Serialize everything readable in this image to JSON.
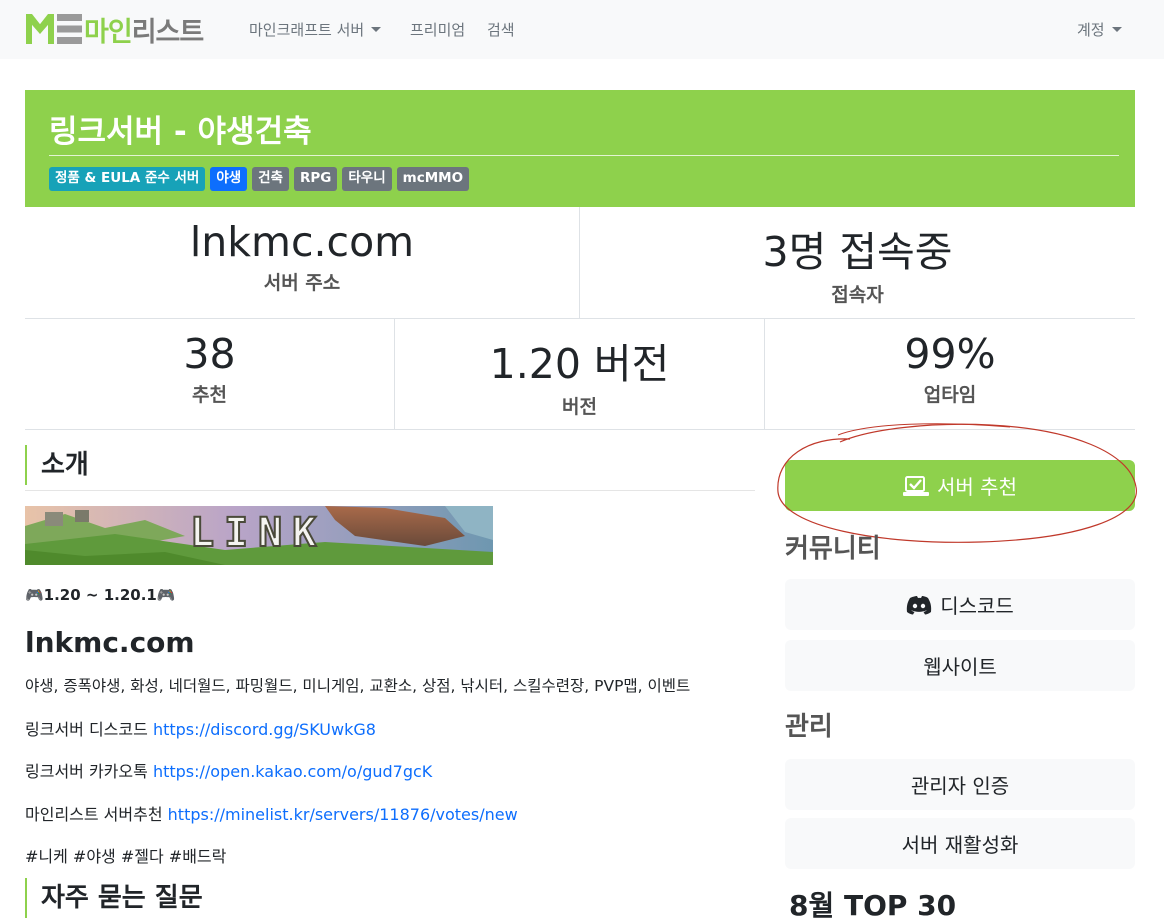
{
  "brand": {
    "logo_text_green": "마인",
    "logo_text_gray": "리스트"
  },
  "nav": {
    "servers": "마인크래프트 서버",
    "premium": "프리미엄",
    "search": "검색",
    "account": "계정"
  },
  "header": {
    "title": "링크서버 - 야생건축",
    "tags": [
      {
        "label": "정품 & EULA 준수 서버",
        "color": "#17a2b8"
      },
      {
        "label": "야생",
        "color": "#0d6efd"
      },
      {
        "label": "건축",
        "color": "#6c757d"
      },
      {
        "label": "RPG",
        "color": "#6c757d"
      },
      {
        "label": "타우니",
        "color": "#6c757d"
      },
      {
        "label": "mcMMO",
        "color": "#6c757d"
      }
    ]
  },
  "stats": {
    "address": {
      "value": "lnkmc.com",
      "label": "서버 주소"
    },
    "players": {
      "value": "3명 접속중",
      "label": "접속자"
    },
    "votes": {
      "value": "38",
      "label": "추천"
    },
    "version": {
      "value": "1.20 버전",
      "label": "버전"
    },
    "uptime": {
      "value": "99%",
      "label": "업타임"
    }
  },
  "intro": {
    "heading": "소개",
    "banner_text": "LINK",
    "version_line": "🎮1.20 ~ 1.20.1🎮",
    "domain": "lnkmc.com",
    "features": "야생, 증폭야생, 화성, 네더월드, 파밍월드, 미니게임, 교환소, 상점, 낚시터, 스킬수련장, PVP맵, 이벤트",
    "discord_label": "링크서버 디스코드 ",
    "discord_url": "https://discord.gg/SKUwkG8",
    "kakao_label": "링크서버 카카오톡 ",
    "kakao_url": "https://open.kakao.com/o/gud7gcK",
    "vote_label": "마인리스트 서버추천 ",
    "vote_url": "https://minelist.kr/servers/11876/votes/new",
    "hashtags": "#니케 #야생 #젤다 #배드락"
  },
  "faq": {
    "heading": "자주 묻는 질문"
  },
  "sidebar": {
    "recommend_button": "서버 추천",
    "community_heading": "커뮤니티",
    "discord_button": "디스코드",
    "website_button": "웹사이트",
    "manage_heading": "관리",
    "admin_verify_button": "관리자 인증",
    "reactivate_button": "서버 재활성화",
    "top30_heading": "8월 TOP 30"
  },
  "colors": {
    "accent": "#8ed14c",
    "annotation_circle": "#c0392b"
  }
}
